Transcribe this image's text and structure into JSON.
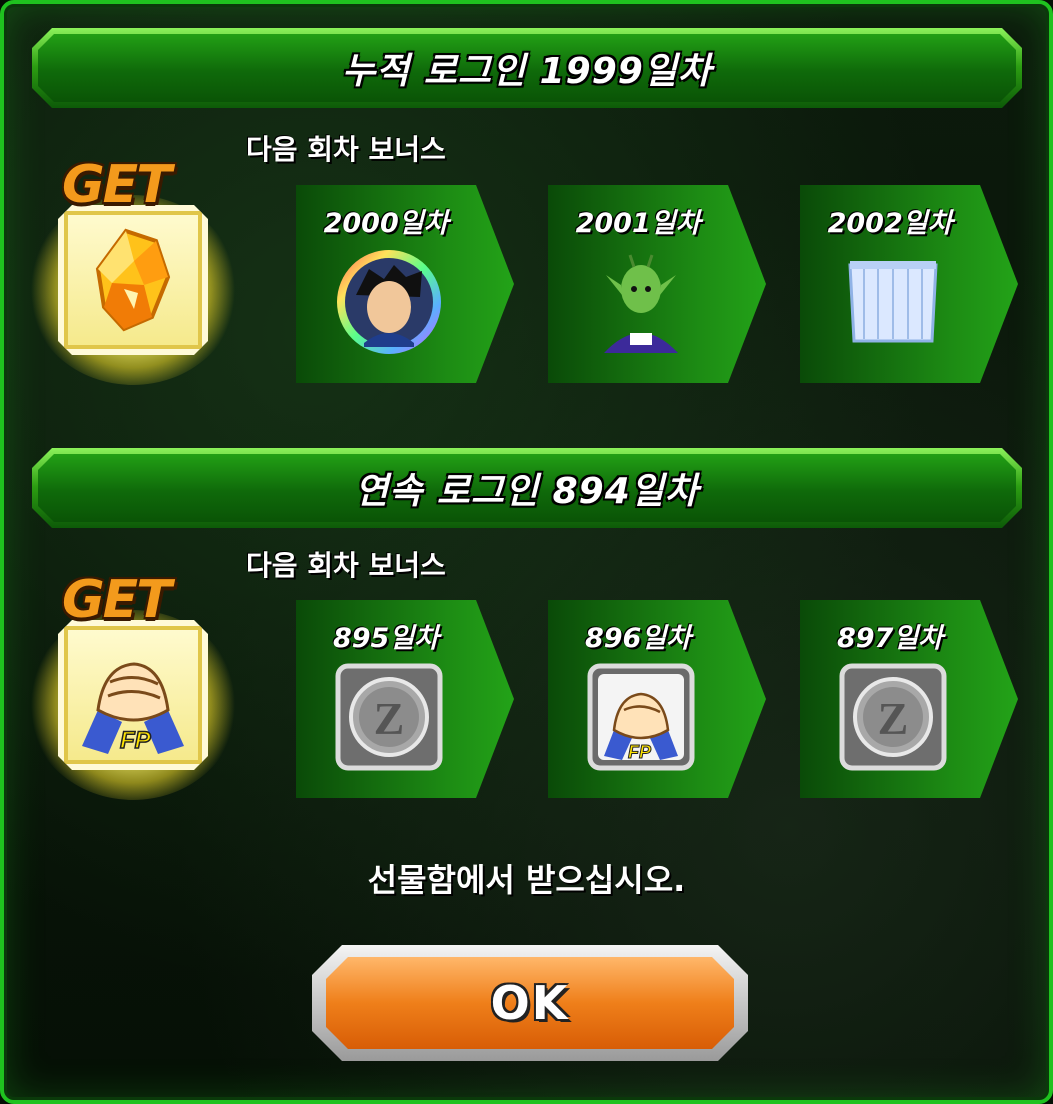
{
  "cumulative": {
    "title": "누적 로그인 1999일차",
    "next_label": "다음 회차 보너스",
    "get_badge": "GET",
    "current_reward_icon": "orange-crystal-icon",
    "days": [
      {
        "label": "2000일차",
        "reward_icon": "character-medal-icon"
      },
      {
        "label": "2001일차",
        "reward_icon": "namekian-character-icon"
      },
      {
        "label": "2002일차",
        "reward_icon": "blue-cloth-item-icon"
      }
    ]
  },
  "consecutive": {
    "title": "연속 로그인 894일차",
    "next_label": "다음 회차 보너스",
    "get_badge": "GET",
    "current_reward_icon": "friend-points-handshake-icon",
    "current_reward_text": "FP",
    "days": [
      {
        "label": "895일차",
        "reward_icon": "silver-z-coin-icon"
      },
      {
        "label": "896일차",
        "reward_icon": "friend-points-handshake-icon",
        "reward_text": "FP"
      },
      {
        "label": "897일차",
        "reward_icon": "silver-z-coin-icon"
      }
    ]
  },
  "message": "선물함에서 받으십시오.",
  "ok_button": "OK",
  "colors": {
    "frame": "#1fc21f",
    "banner": "#22a015",
    "get": "#f39a1c",
    "ok": "#ef7f1a"
  }
}
